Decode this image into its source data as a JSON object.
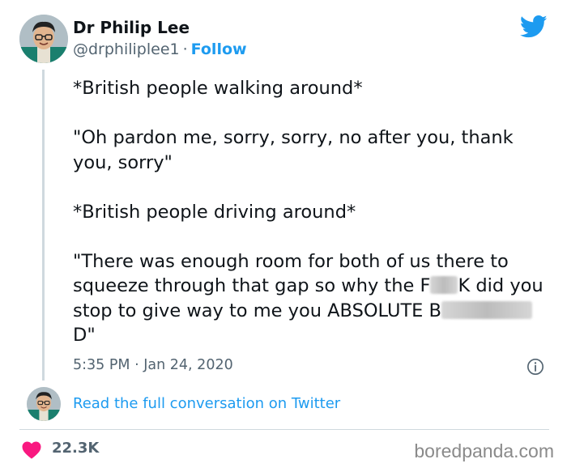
{
  "author": {
    "name": "Dr Philip Lee",
    "handle": "@drphiliplee1",
    "separator": "·",
    "follow_label": "Follow"
  },
  "tweet": {
    "line1": "*British people walking around*",
    "line2": "\"Oh pardon me, sorry, sorry, no after you, thank you, sorry\"",
    "line3": "*British people driving around*",
    "line4_part1": "\"There was enough room for both of us there to squeeze through that gap so why the F",
    "line4_part2": "K did you stop to give way to me you ABSOLUTE B",
    "line4_part3": "D\""
  },
  "meta": {
    "time": "5:35 PM",
    "separator": "·",
    "date": "Jan 24, 2020"
  },
  "conversation_link": "Read the full conversation on Twitter",
  "likes": {
    "count": "22.3K"
  },
  "watermark": "boredpanda.com",
  "icons": {
    "brand": "twitter-bird-icon",
    "info": "info-icon",
    "like": "heart-icon"
  },
  "colors": {
    "accent": "#1d9bf0",
    "heart": "#f91880",
    "muted": "#536471",
    "text": "#0f1419"
  }
}
